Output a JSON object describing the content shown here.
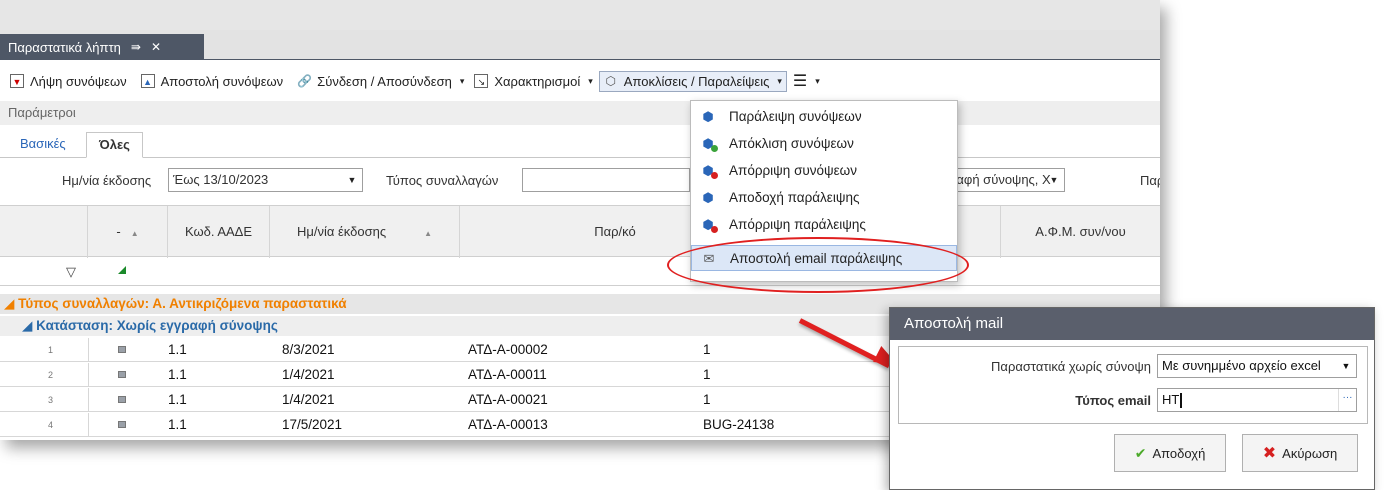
{
  "window": {
    "doc_tab_label": "Παραστατικά λήπτη",
    "pin_glyph": "⇛",
    "close_glyph": "✕"
  },
  "toolbar": {
    "items": [
      {
        "label": "Λήψη συνόψεων",
        "icon": "download-doc-icon"
      },
      {
        "label": "Αποστολή συνόψεων",
        "icon": "upload-doc-icon"
      },
      {
        "label": "Σύνδεση / Αποσύνδεση",
        "icon": "link-icon"
      },
      {
        "label": "Χαρακτηρισμοί",
        "icon": "tag-doc-icon"
      },
      {
        "label": "Αποκλίσεις / Παραλείψεις",
        "icon": "deviation-icon"
      }
    ],
    "caret": "▾",
    "more_glyph": "☰"
  },
  "params": {
    "title": "Παράμετροι",
    "tabs": [
      "Βασικές",
      "Όλες"
    ]
  },
  "filters": {
    "date_label": "Ημ/νία έκδοσης",
    "date_value": "Έως 13/10/2023",
    "type_label": "Τύπος συναλλαγών",
    "type_value": "",
    "status_value": "ραφή σύνοψης, Χ",
    "extra_label": "Παρ"
  },
  "grid": {
    "headers": [
      "-",
      "Κωδ. ΑΑΔΕ",
      "Ημ/νία έκδοσης",
      "Παρ/κό",
      "Α.Φ.Μ. συν/νου"
    ],
    "group1": "◢ Τύπος συναλλαγών:  Α. Αντικριζόμενα παραστατικά",
    "group2": "◢ Κατάσταση:  Χωρίς εγγραφή σύνοψης",
    "rows": [
      {
        "n": "1",
        "code": "1.1",
        "date": "8/3/2021",
        "doc": "ΑΤΔ-Α-00002",
        "extra": "1"
      },
      {
        "n": "2",
        "code": "1.1",
        "date": "1/4/2021",
        "doc": "ΑΤΔ-Α-00011",
        "extra": "1"
      },
      {
        "n": "3",
        "code": "1.1",
        "date": "1/4/2021",
        "doc": "ΑΤΔ-Α-00021",
        "extra": "1"
      },
      {
        "n": "4",
        "code": "1.1",
        "date": "17/5/2021",
        "doc": "ΑΤΔ-Α-00013",
        "extra": "BUG-24138"
      }
    ]
  },
  "menu": {
    "items": [
      {
        "label": "Παράλειψη συνόψεων",
        "icon": "cube-icon",
        "badge": ""
      },
      {
        "label": "Απόκλιση συνόψεων",
        "icon": "cube-plus-icon",
        "badge": "#3aa33a"
      },
      {
        "label": "Απόρριψη συνόψεων",
        "icon": "cube-reject-icon",
        "badge": "#d62020"
      },
      {
        "label": "Αποδοχή παράλειψης",
        "icon": "cube-accept-icon",
        "badge": ""
      },
      {
        "label": "Απόρριψη παράλειψης",
        "icon": "cube-stop-icon",
        "badge": "#d62020"
      },
      {
        "label": "Αποστολή email παράλειψης",
        "icon": "email-icon",
        "badge": ""
      }
    ],
    "highlighted_index": 5
  },
  "dialog": {
    "title": "Αποστολή mail",
    "field1_label": "Παραστατικά χωρίς σύνοψη",
    "field1_value": "Με συνημμένο αρχείο excel",
    "field2_label": "Τύπος email",
    "field2_value": "HT",
    "accept_label": "Αποδοχή",
    "cancel_label": "Ακύρωση"
  },
  "colors": {
    "accent": "#2a66b8",
    "group_orange": "#f08000",
    "annotation_red": "#e02020",
    "title_bar": "#4e5766"
  }
}
